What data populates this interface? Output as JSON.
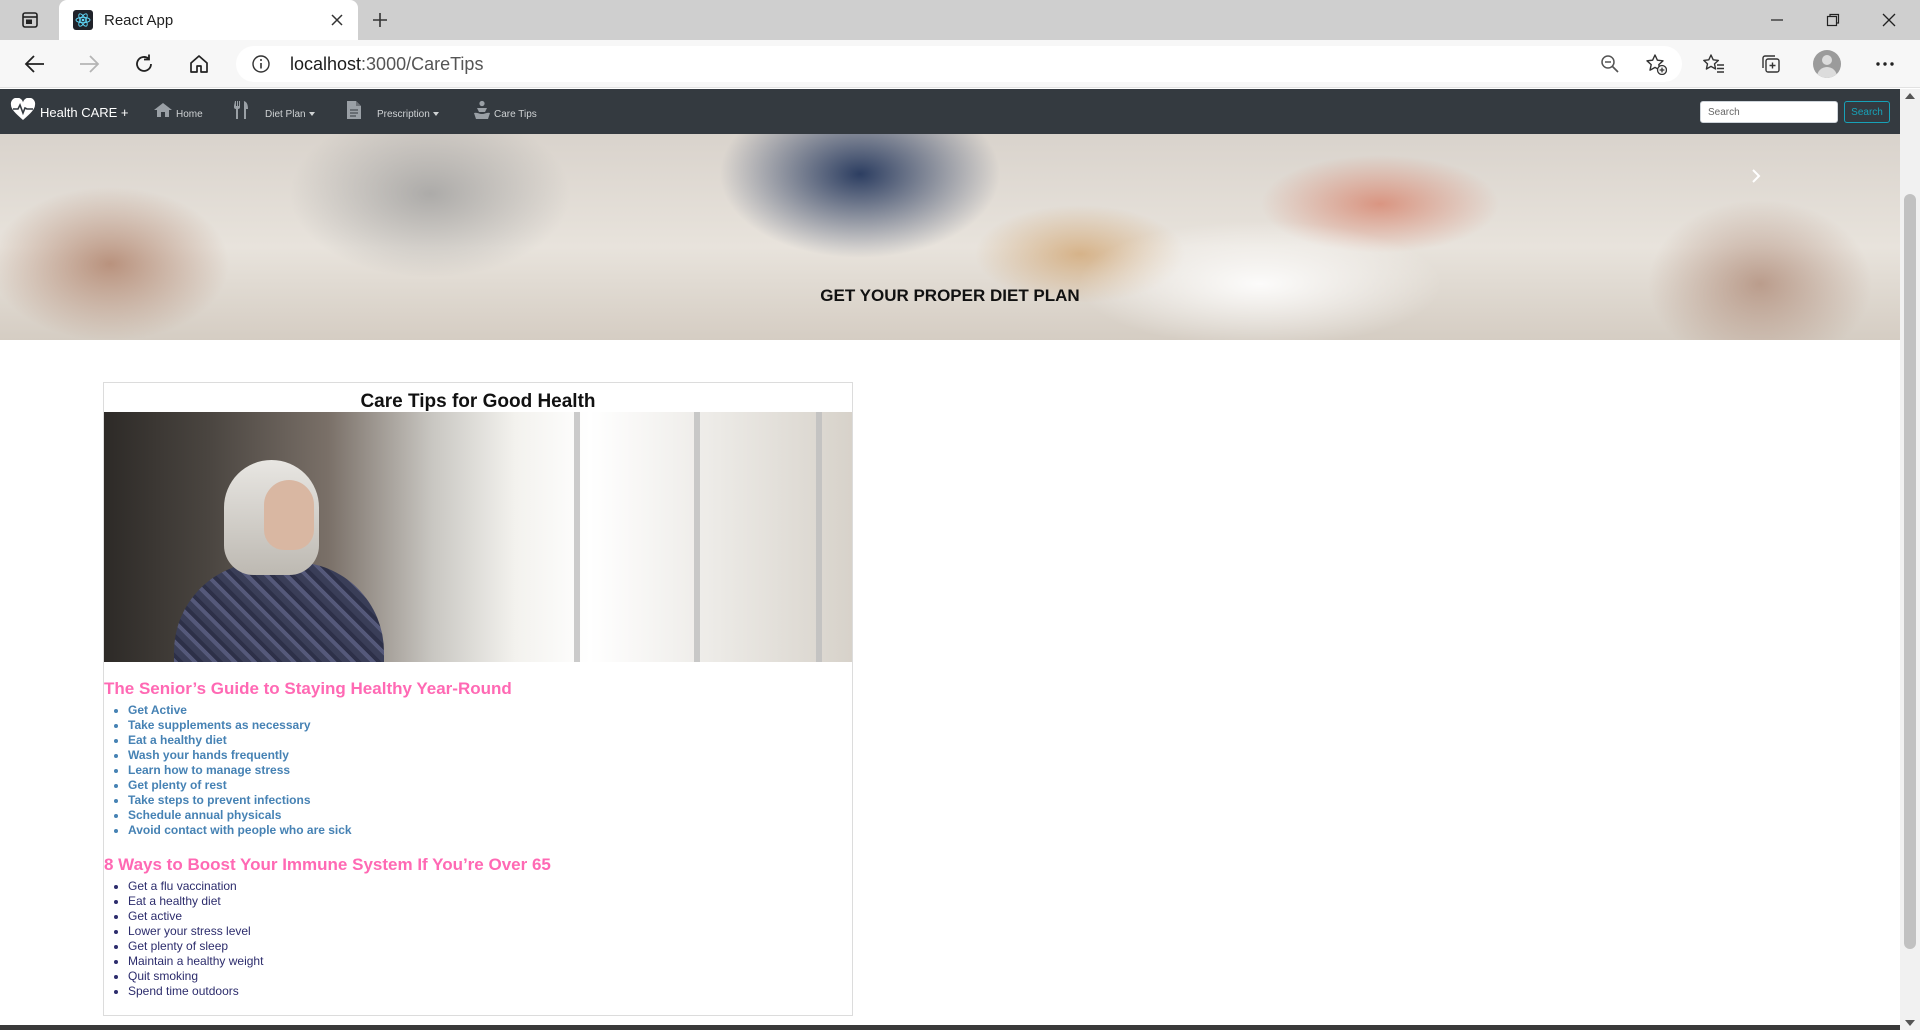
{
  "browser": {
    "tab_title": "React App",
    "url_host": "localhost",
    "url_path": ":3000/CareTips"
  },
  "navbar": {
    "brand": "Health CARE +",
    "items": [
      {
        "label": "Home"
      },
      {
        "label": "Diet Plan"
      },
      {
        "label": "Prescription"
      },
      {
        "label": "Care Tips"
      }
    ],
    "search_placeholder": "Search",
    "search_button": "Search"
  },
  "banner": {
    "caption": "GET YOUR PROPER DIET PLAN"
  },
  "card": {
    "title": "Care Tips for Good Health",
    "section1": {
      "title": "The Senior’s Guide to Staying Healthy Year-Round",
      "items": [
        "Get Active",
        "Take supplements as necessary",
        "Eat a healthy diet",
        "Wash your hands frequently",
        "Learn how to manage stress",
        "Get plenty of rest",
        "Take steps to prevent infections",
        "Schedule annual physicals",
        "Avoid contact with people who are sick"
      ]
    },
    "section2": {
      "title": "8 Ways to Boost Your Immune System If You’re Over 65",
      "items": [
        "Get a flu vaccination",
        "Eat a healthy diet",
        "Get active",
        "Lower your stress level",
        "Get plenty of sleep",
        "Maintain a healthy weight",
        "Quit smoking",
        "Spend time outdoors"
      ]
    }
  },
  "colors": {
    "navbar_bg": "#343a40",
    "section_title": "#ff69b4",
    "tip_bold": "#4682b4",
    "tip_plain": "#2c2c6c",
    "search_accent": "#17a2b8"
  }
}
